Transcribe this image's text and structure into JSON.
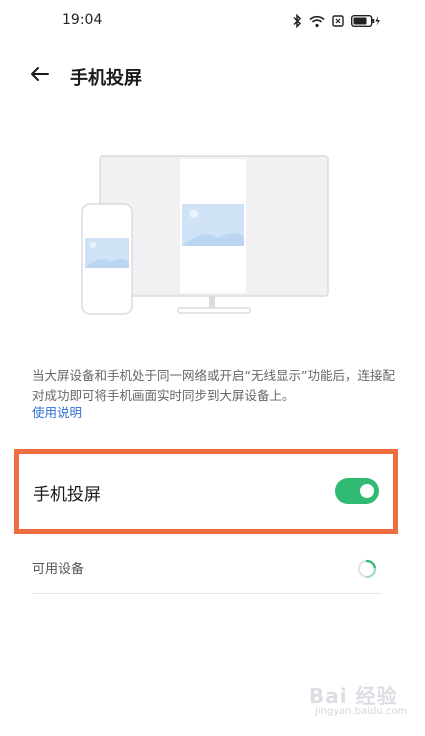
{
  "status_bar": {
    "time": "19:04",
    "icons": [
      "bluetooth-icon",
      "wifi-icon",
      "sim-icon",
      "battery-charging-icon"
    ]
  },
  "header": {
    "back_icon": "arrow-left-icon",
    "title": "手机投屏"
  },
  "illustration": {
    "description_icons": [
      "monitor",
      "phone",
      "image-placeholder"
    ]
  },
  "description": {
    "text": "当大屏设备和手机处于同一网络或开启“无线显示”功能后，连接配对成功即可将手机画面实时同步到大屏设备上。",
    "link": "使用说明"
  },
  "cast_setting": {
    "label": "手机投屏",
    "enabled": true
  },
  "available_devices": {
    "label": "可用设备",
    "loading": true
  },
  "watermark": {
    "main": "Bai 经验",
    "sub": "jingyan.baidu.com"
  },
  "colors": {
    "accent_green": "#2fbb74",
    "link_blue": "#2f6fd6",
    "highlight_orange": "#ef6e41"
  }
}
